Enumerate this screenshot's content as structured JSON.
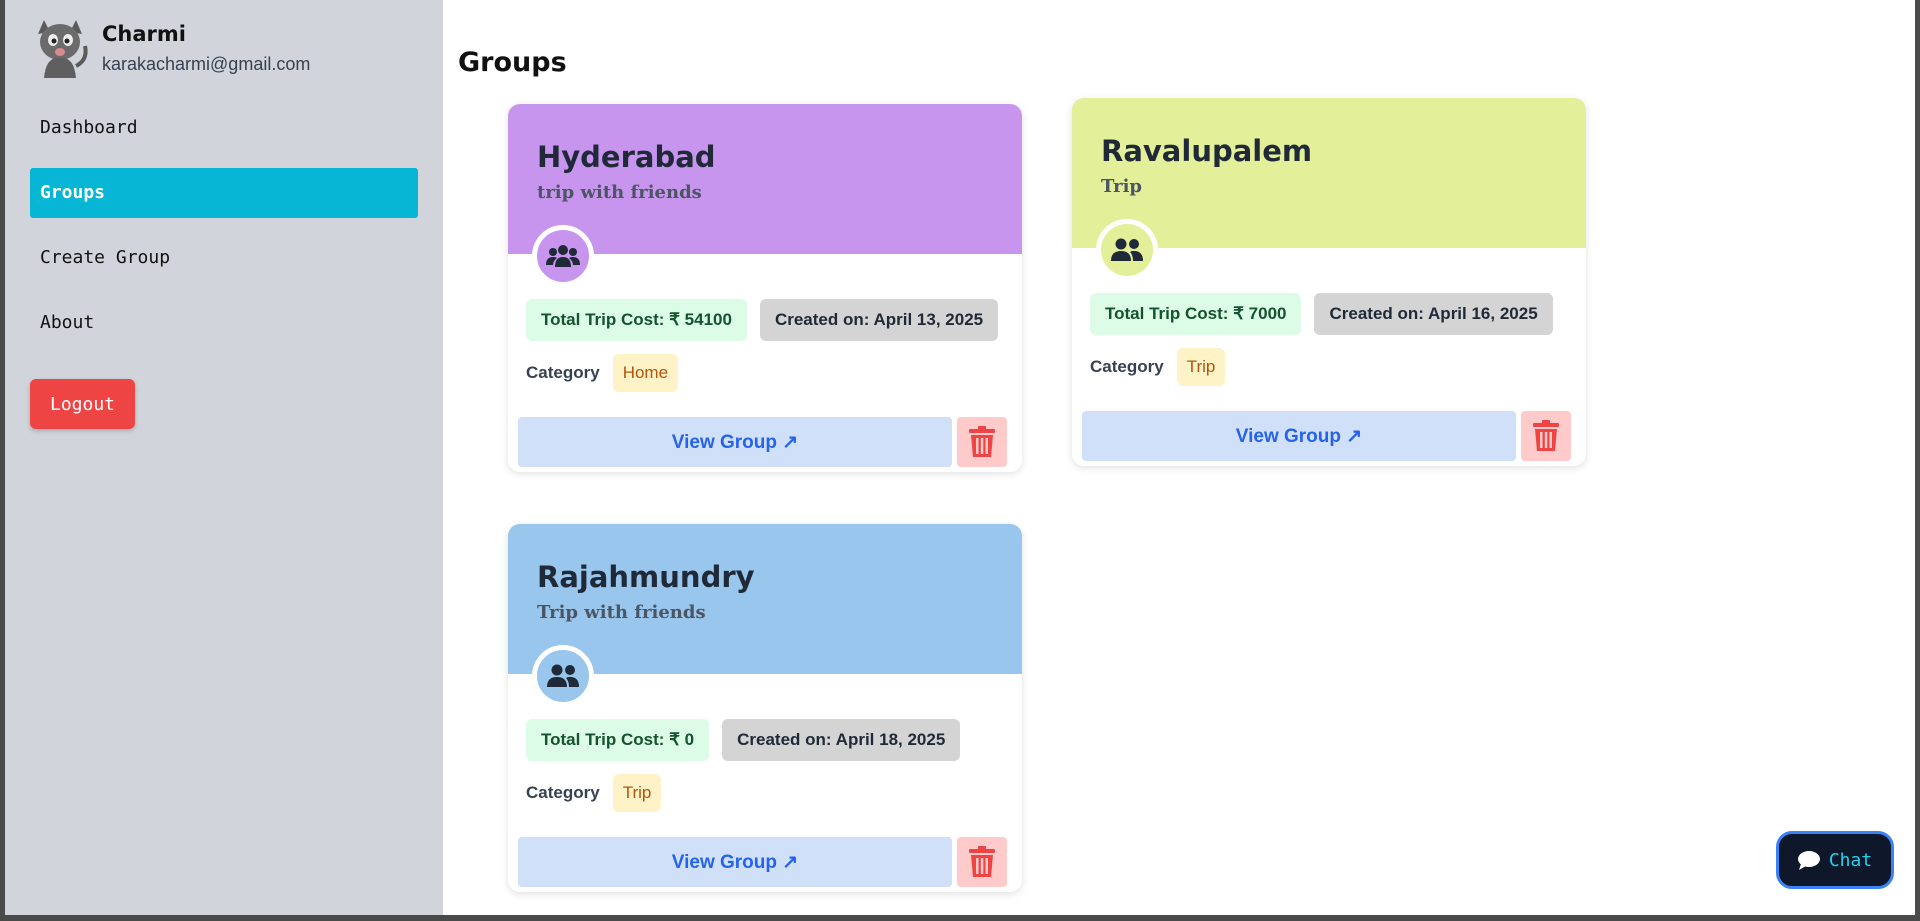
{
  "user": {
    "name": "Charmi",
    "email": "karakacharmi@gmail.com"
  },
  "nav": {
    "items": [
      {
        "label": "Dashboard"
      },
      {
        "label": "Groups"
      },
      {
        "label": "Create Group"
      },
      {
        "label": "About"
      }
    ],
    "active": "Groups",
    "logout_label": "Logout"
  },
  "page": {
    "title": "Groups"
  },
  "groups": [
    {
      "name": "Hyderabad",
      "description": "trip with friends",
      "cost": "Total Trip Cost: ₹ 54100",
      "created": "Created on: April 13, 2025",
      "category_label": "Category",
      "category": "Home",
      "view_label": "View Group ↗",
      "color": "#c795ee",
      "icon": "users-icon"
    },
    {
      "name": "Ravalupalem",
      "description": "Trip",
      "cost": "Total Trip Cost: ₹ 7000",
      "created": "Created on: April 16, 2025",
      "category_label": "Category",
      "category": "Trip",
      "view_label": "View Group ↗",
      "color": "#e4ef99",
      "icon": "user-friends-icon"
    },
    {
      "name": "Rajahmundry",
      "description": "Trip with friends",
      "cost": "Total Trip Cost: ₹ 0",
      "created": "Created on: April 18, 2025",
      "category_label": "Category",
      "category": "Trip",
      "view_label": "View Group ↗",
      "color": "#98c6ec",
      "icon": "user-friends-icon"
    }
  ],
  "chat": {
    "label": "Chat"
  },
  "colors": {
    "sidebar": "#d1d5db",
    "active_nav": "#06b6d4",
    "logout": "#ef4444",
    "view_button_bg": "#d1e0f9",
    "delete_button_bg": "#fecaca"
  }
}
